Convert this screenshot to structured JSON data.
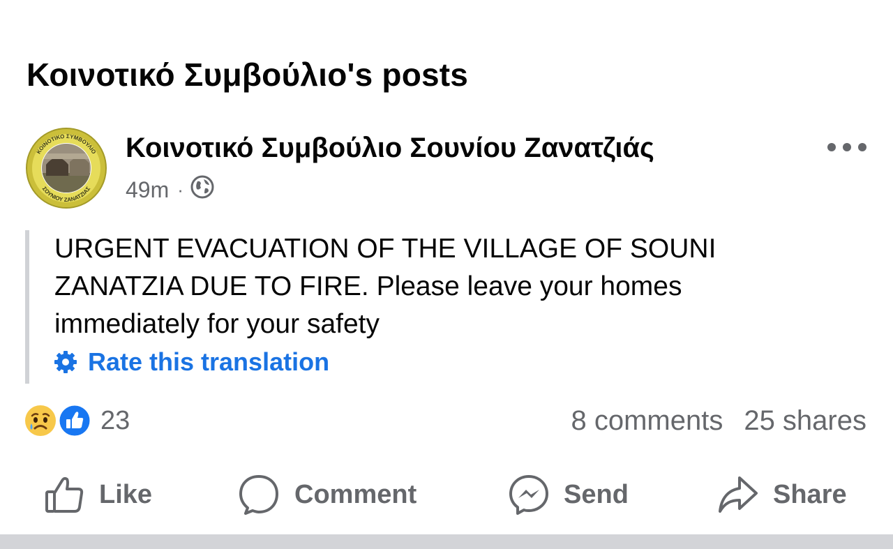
{
  "section": {
    "title": "Κοινοτικό Συμβούλιο's posts"
  },
  "post": {
    "author": "Κοινοτικό Συμβούλιο Σουνίου Ζανατζιάς",
    "avatar_text": {
      "top": "ΚΟΙΝΟΤΙΚΟ ΣΥΜΒΟΥΛΙΟ",
      "bottom": "ΣΟΥΝΙΟΥ ΖΑΝΑΤΖΙΑΣ"
    },
    "time": "49m",
    "separator": "·",
    "audience_icon": "globe-icon",
    "text": "URGENT EVACUATION OF THE VILLAGE OF SOUNI ZANATZIA DUE TO FIRE. Please leave your homes immediately for your safety",
    "rate_label": "Rate this translation",
    "more_icon": "more-options-icon"
  },
  "stats": {
    "reaction_icons": [
      "sad-reaction-icon",
      "like-reaction-icon"
    ],
    "reaction_count": "23",
    "comments": "8 comments",
    "shares": "25 shares"
  },
  "actions": {
    "like": "Like",
    "comment": "Comment",
    "send": "Send",
    "share": "Share"
  },
  "colors": {
    "text": "#050505",
    "secondary": "#65676b",
    "link": "#1a73e3",
    "like_blue": "#1877f2",
    "divider": "#d3d4d8"
  }
}
